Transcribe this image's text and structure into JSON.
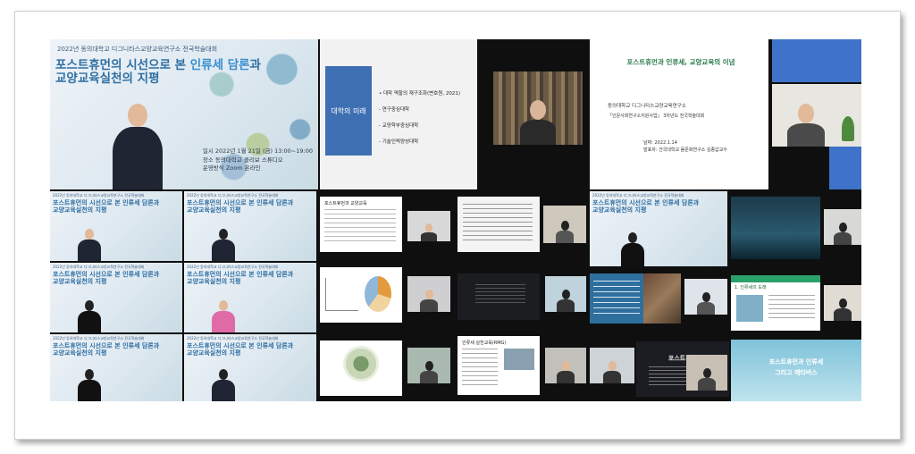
{
  "main_poster": {
    "header": "2022년 동의대학교 디그니타스교양교육연구소 전국학술대회",
    "title_line1_a": "포스트휴먼의 시선으로 본 ",
    "title_line1_b": "인류세 담론",
    "title_line1_c": "과",
    "title_line2_a": "교양교육실천",
    "title_line2_b": "의 지평",
    "info_date": "일시 2022년 1월 21일 (금) 13:00~19:00",
    "info_place": "장소 동의대학교 콜리보 스튜디오",
    "info_method": "운영방식 Zoom 온라인"
  },
  "small_poster": {
    "header": "2022년 동의대학교 디그니타스교양교육연구소 전국학술대회",
    "line1": "포스트휴먼의 시선으로 본 인류세 담론과",
    "line2": "교양교육실천의 지평"
  },
  "slide_future": {
    "sidebar": "대학의 미래",
    "items": [
      "• 대학 역할의 재구조화(변호원, 2021)",
      "- 연구중심대학",
      "- 교양학부중심대학",
      "- 기술인력양성대학"
    ]
  },
  "slide_title": {
    "title": "포스트휴먼과 인류세, 교양교육의 이념",
    "org1": "동의대학교 디그니타스교양교육연구소",
    "org2": "「인문사회연구소지원사업」 3차년도 전국학술대회",
    "date": "날짜: 2022.1.14",
    "presenter": "발표자: 건국대학교 몸문화연구소 김종갑교수"
  },
  "thumb_texts": {
    "posthuman_edu": "포스트휴먼과 교양교육",
    "pedagogy": "인류세 실천교육(RMG)",
    "dark_title": "포스트휴먼",
    "scenario": "1. 인류세의 도래",
    "metaverse_a": "포스트휴먼과 인류세",
    "metaverse_b": "그리고 메타버스"
  }
}
